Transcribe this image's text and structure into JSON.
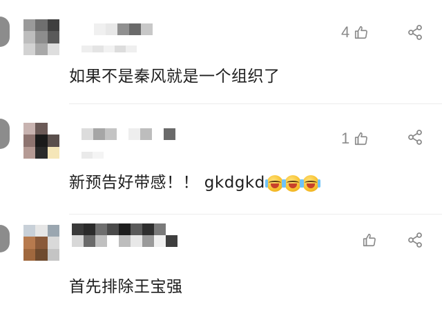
{
  "comments": [
    {
      "text": "如果不是秦风就是一个组织了",
      "likes": "4",
      "like_icon": "thumbs-up-icon",
      "share_icon": "share-icon"
    },
    {
      "text": "新预告好带感！！ gkdgkd",
      "emoji": [
        "crying-laughing-emoji",
        "crying-laughing-emoji",
        "crying-laughing-emoji"
      ],
      "likes": "1",
      "like_icon": "thumbs-up-icon",
      "share_icon": "share-icon"
    },
    {
      "text": "首先排除王宝强",
      "likes": "",
      "like_icon": "thumbs-up-icon",
      "share_icon": "share-icon"
    }
  ],
  "colors": {
    "text": "#1e1e1e",
    "icon_gray": "#8a8a8a",
    "separator": "#ececec"
  }
}
